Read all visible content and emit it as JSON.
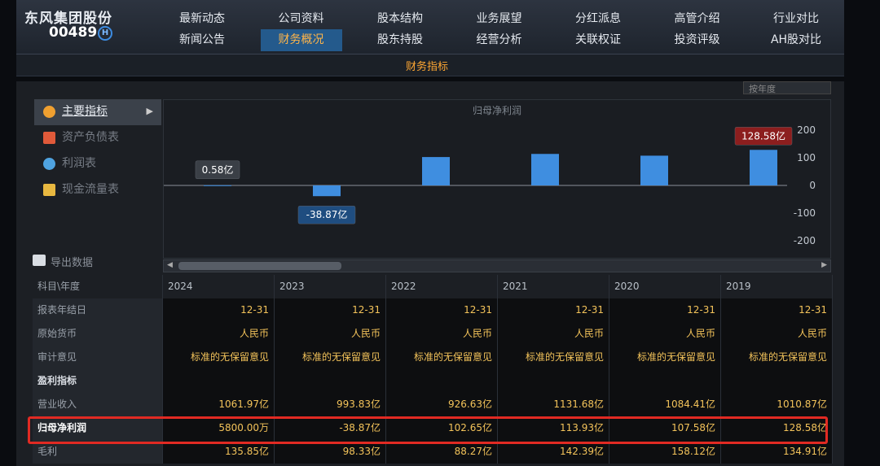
{
  "company": {
    "name": "东风集团股份",
    "code": "00489",
    "hk_badge": "H"
  },
  "nav": {
    "row1": [
      "最新动态",
      "公司资料",
      "股本结构",
      "业务展望",
      "分红派息",
      "高管介绍",
      "行业对比"
    ],
    "row2": [
      "新闻公告",
      "财务概况",
      "股东持股",
      "经营分析",
      "关联权证",
      "投资评级",
      "AH股对比"
    ],
    "active": "财务概况"
  },
  "subtab": "财务指标",
  "period_select": "按年度",
  "sidebar": {
    "items": [
      {
        "label": "主要指标",
        "icon": "asterisk-icon"
      },
      {
        "label": "资产负债表",
        "icon": "document-icon"
      },
      {
        "label": "利润表",
        "icon": "pie-icon"
      },
      {
        "label": "现金流量表",
        "icon": "coins-icon"
      }
    ],
    "arrow": "▶",
    "export": "导出数据"
  },
  "chart_data": {
    "type": "bar",
    "title": "归母净利润",
    "categories": [
      "2024",
      "2023",
      "2022",
      "2021",
      "2020",
      "2019"
    ],
    "values": [
      0.58,
      -38.87,
      102.65,
      113.93,
      107.58,
      128.58
    ],
    "value_labels": {
      "2024": "0.58亿",
      "2023": "-38.87亿",
      "2019": "128.58亿"
    },
    "ylim": [
      -250,
      250
    ],
    "yticks": [
      200,
      100,
      0,
      -100,
      -200
    ],
    "bar_color": "#3f8ee0",
    "label_colors": {
      "positive": "#3a3f46",
      "negative": "#1f4d80",
      "highlight": "#8c1e1e"
    }
  },
  "table": {
    "header_label": "科目\\年度",
    "years": [
      "2024",
      "2023",
      "2022",
      "2021",
      "2020",
      "2019"
    ],
    "rows": [
      {
        "label": "报表年结日",
        "values": [
          "12-31",
          "12-31",
          "12-31",
          "12-31",
          "12-31",
          "12-31"
        ]
      },
      {
        "label": "原始货币",
        "values": [
          "人民币",
          "人民币",
          "人民币",
          "人民币",
          "人民币",
          "人民币"
        ]
      },
      {
        "label": "审计意见",
        "values": [
          "标准的无保留意见",
          "标准的无保留意见",
          "标准的无保留意见",
          "标准的无保留意见",
          "标准的无保留意见",
          "标准的无保留意见"
        ]
      },
      {
        "label": "盈利指标",
        "values": [
          "",
          "",
          "",
          "",
          "",
          ""
        ],
        "section": true
      },
      {
        "label": "营业收入",
        "values": [
          "1061.97亿",
          "993.83亿",
          "926.63亿",
          "1131.68亿",
          "1084.41亿",
          "1010.87亿"
        ]
      },
      {
        "label": "归母净利润",
        "values": [
          "5800.00万",
          "-38.87亿",
          "102.65亿",
          "113.93亿",
          "107.58亿",
          "128.58亿"
        ],
        "highlight": true
      },
      {
        "label": "毛利",
        "values": [
          "135.85亿",
          "98.33亿",
          "88.27亿",
          "142.39亿",
          "158.12亿",
          "134.91亿"
        ]
      }
    ]
  }
}
